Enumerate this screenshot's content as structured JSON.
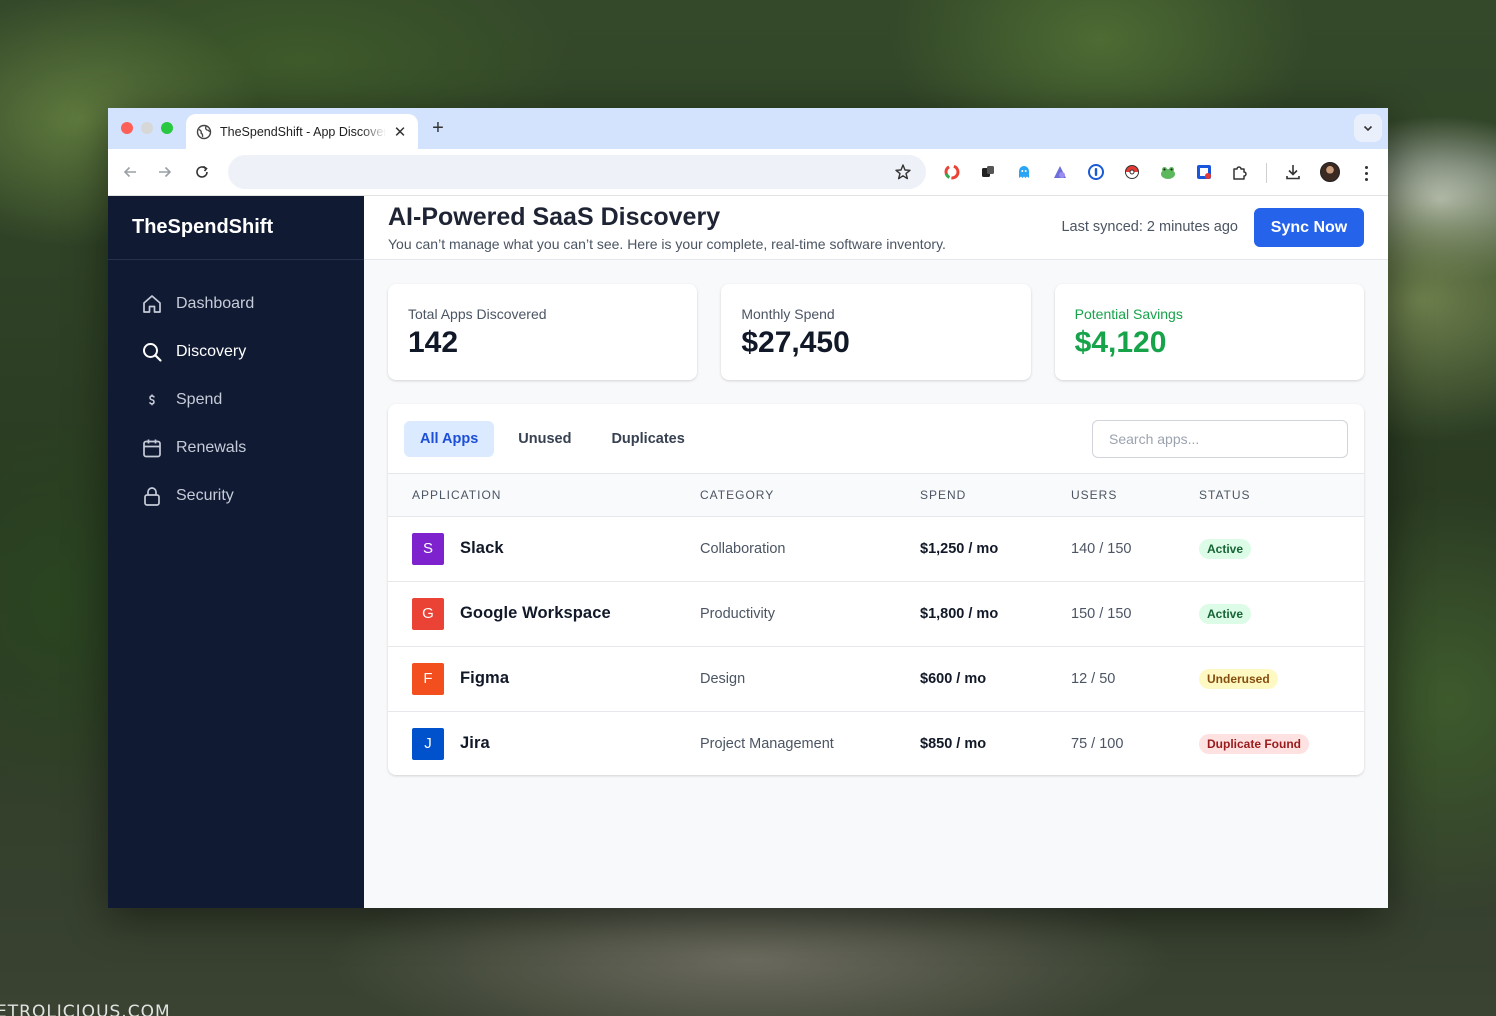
{
  "browser": {
    "tab_title": "TheSpendShift - App Discovery",
    "tab_close": "✕",
    "new_tab": "+"
  },
  "wallpaper": {
    "watermark": "ETROLICIOUS.COM"
  },
  "brand": {
    "name": "TheSpendShift"
  },
  "sidebar": {
    "items": [
      {
        "label": "Dashboard",
        "icon": "home-icon"
      },
      {
        "label": "Discovery",
        "icon": "search-icon",
        "active": true
      },
      {
        "label": "Spend",
        "icon": "dollar-icon"
      },
      {
        "label": "Renewals",
        "icon": "calendar-icon"
      },
      {
        "label": "Security",
        "icon": "lock-icon"
      }
    ]
  },
  "header": {
    "title": "AI-Powered SaaS Discovery",
    "subtitle": "You can’t manage what you can’t see. Here is your complete, real-time software inventory.",
    "last_synced": "Last synced: 2 minutes ago",
    "sync_button": "Sync Now"
  },
  "stats": [
    {
      "label": "Total Apps Discovered",
      "value": "142"
    },
    {
      "label": "Monthly Spend",
      "value": "$27,450"
    },
    {
      "label": "Potential Savings",
      "value": "$4,120"
    }
  ],
  "filters": {
    "tabs": [
      "All Apps",
      "Unused",
      "Duplicates"
    ],
    "active": "All Apps",
    "search_placeholder": "Search apps..."
  },
  "table": {
    "columns": [
      "APPLICATION",
      "CATEGORY",
      "SPEND",
      "USERS",
      "STATUS"
    ],
    "rows": [
      {
        "initial": "S",
        "color": "#7e22ce",
        "name": "Slack",
        "category": "Collaboration",
        "spend": "$1,250 / mo",
        "users": "140 / 150",
        "status": "Active"
      },
      {
        "initial": "G",
        "color": "#ea4335",
        "name": "Google Workspace",
        "category": "Productivity",
        "spend": "$1,800 / mo",
        "users": "150 / 150",
        "status": "Active"
      },
      {
        "initial": "F",
        "color": "#f24e1e",
        "name": "Figma",
        "category": "Design",
        "spend": "$600 / mo",
        "users": "12 / 50",
        "status": "Underused"
      },
      {
        "initial": "J",
        "color": "#0052cc",
        "name": "Jira",
        "category": "Project Management",
        "spend": "$850 / mo",
        "users": "75 / 100",
        "status": "Duplicate Found"
      }
    ]
  },
  "status_colors": {
    "Active": {
      "bg": "#dcfce7",
      "fg": "#166534"
    },
    "Underused": {
      "bg": "#fef9c3",
      "fg": "#854d0e"
    },
    "Duplicate Found": {
      "bg": "#fee2e2",
      "fg": "#991b1b"
    }
  }
}
